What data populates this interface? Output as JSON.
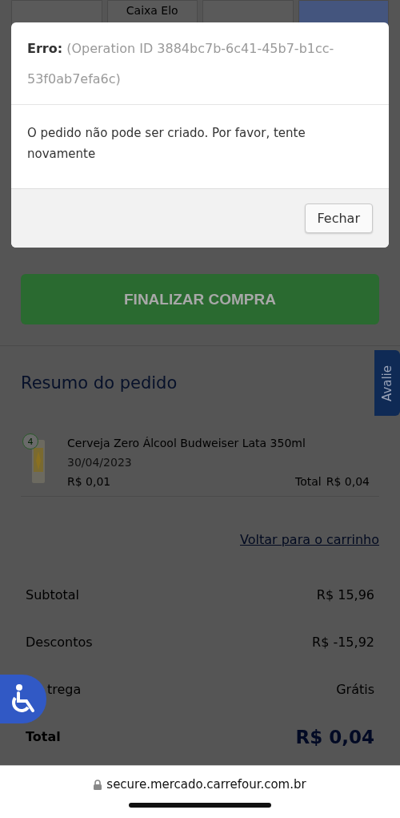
{
  "payment_tabs": [
    {
      "selected": false
    },
    {
      "label": "Caixa Elo",
      "selected": false
    },
    {
      "selected": false
    },
    {
      "selected": true
    }
  ],
  "dialog": {
    "error_label": "Erro:",
    "error_detail": "(Operation ID 3884bc7b-6c41-45b7-b1cc-53f0ab7efa6c)",
    "message": "O pedido não pode ser criado. Por favor, tente novamente",
    "close_button": "Fechar"
  },
  "checkout_button": "FINALIZAR COMPRA",
  "feedback_tab": "Avalie",
  "summary": {
    "title": "Resumo do pedido",
    "items": [
      {
        "quantity": "4",
        "name": "Cerveja Zero Álcool Budweiser Lata 350ml",
        "date": "30/04/2023",
        "unit_price": "R$ 0,01",
        "total_label": "Total",
        "total": "R$ 0,04"
      }
    ],
    "back_link": "Voltar para o carrinho",
    "rows": [
      {
        "kind": "normal",
        "label": "Subtotal",
        "value": "R$ 15,96"
      },
      {
        "kind": "normal",
        "label": "Descontos",
        "value": "R$ -15,92"
      },
      {
        "kind": "covered",
        "label": "trega",
        "value": "Grátis"
      },
      {
        "kind": "total",
        "label": "Total",
        "value": "R$ 0,04"
      }
    ]
  },
  "browser": {
    "url": "secure.mercado.carrefour.com.br"
  }
}
